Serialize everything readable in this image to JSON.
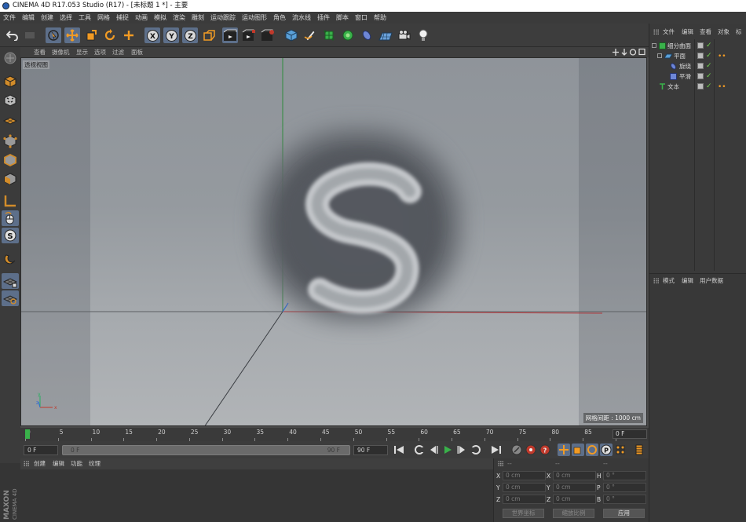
{
  "window": {
    "title": "CINEMA 4D R17.053 Studio (R17) - [未标题 1 *] - 主要"
  },
  "menu": [
    "文件",
    "编辑",
    "创建",
    "选择",
    "工具",
    "网格",
    "捕捉",
    "动画",
    "模拟",
    "渲染",
    "雕刻",
    "运动跟踪",
    "运动图形",
    "角色",
    "流水线",
    "插件",
    "脚本",
    "窗口",
    "帮助"
  ],
  "toolbar": {
    "axis_x": "X",
    "axis_y": "Y",
    "axis_z": "Z"
  },
  "viewport": {
    "menu": [
      "查看",
      "摄像机",
      "显示",
      "选项",
      "过滤",
      "面板"
    ],
    "label": "透视视图",
    "grid_spacing": "网格间距 : 1000 cm",
    "logo_letter": "S"
  },
  "timeline": {
    "ticks": [
      "0",
      "5",
      "10",
      "15",
      "20",
      "25",
      "30",
      "35",
      "40",
      "45",
      "50",
      "55",
      "60",
      "65",
      "70",
      "75",
      "80",
      "85",
      "90"
    ],
    "current_frame": "0 F"
  },
  "playbar": {
    "start": "0 F",
    "range_start": "0 F",
    "range_end": "90 F",
    "end": "90 F",
    "key_p": "P"
  },
  "material_panel": {
    "tabs": [
      "创建",
      "编辑",
      "功能",
      "纹理"
    ],
    "logo_top": "MAXON",
    "logo_bottom": "CINEMA 4D"
  },
  "coordinates": {
    "headers": [
      "--",
      "--",
      "--"
    ],
    "rows": [
      {
        "pos_axis": "X",
        "pos": "0 cm",
        "size_axis": "X",
        "size": "0 cm",
        "rot_axis": "H",
        "rot": "0 °"
      },
      {
        "pos_axis": "Y",
        "pos": "0 cm",
        "size_axis": "Y",
        "size": "0 cm",
        "rot_axis": "P",
        "rot": "0 °"
      },
      {
        "pos_axis": "Z",
        "pos": "0 cm",
        "size_axis": "Z",
        "size": "0 cm",
        "rot_axis": "B",
        "rot": "0 °"
      }
    ],
    "world_coords": "世界坐标",
    "scale_ratio": "缩放比例",
    "apply": "应用"
  },
  "object_manager": {
    "tabs": [
      "文件",
      "编辑",
      "查看",
      "对象",
      "标签"
    ],
    "objects": [
      {
        "name": "细分曲面",
        "indent": 1
      },
      {
        "name": "平面",
        "indent": 2
      },
      {
        "name": "旋绕",
        "indent": 3
      },
      {
        "name": "平滑",
        "indent": 3
      },
      {
        "name": "文本",
        "indent": 1
      }
    ]
  },
  "attribute_manager": {
    "tabs": [
      "模式",
      "编辑",
      "用户数据"
    ]
  },
  "colors": {
    "highlight": "#5d6f8a",
    "axis_red": "#c0392b",
    "axis_green": "#27ae60",
    "axis_blue": "#2e6bd6",
    "orange": "#f29b24",
    "check_green": "#6fd04b"
  }
}
